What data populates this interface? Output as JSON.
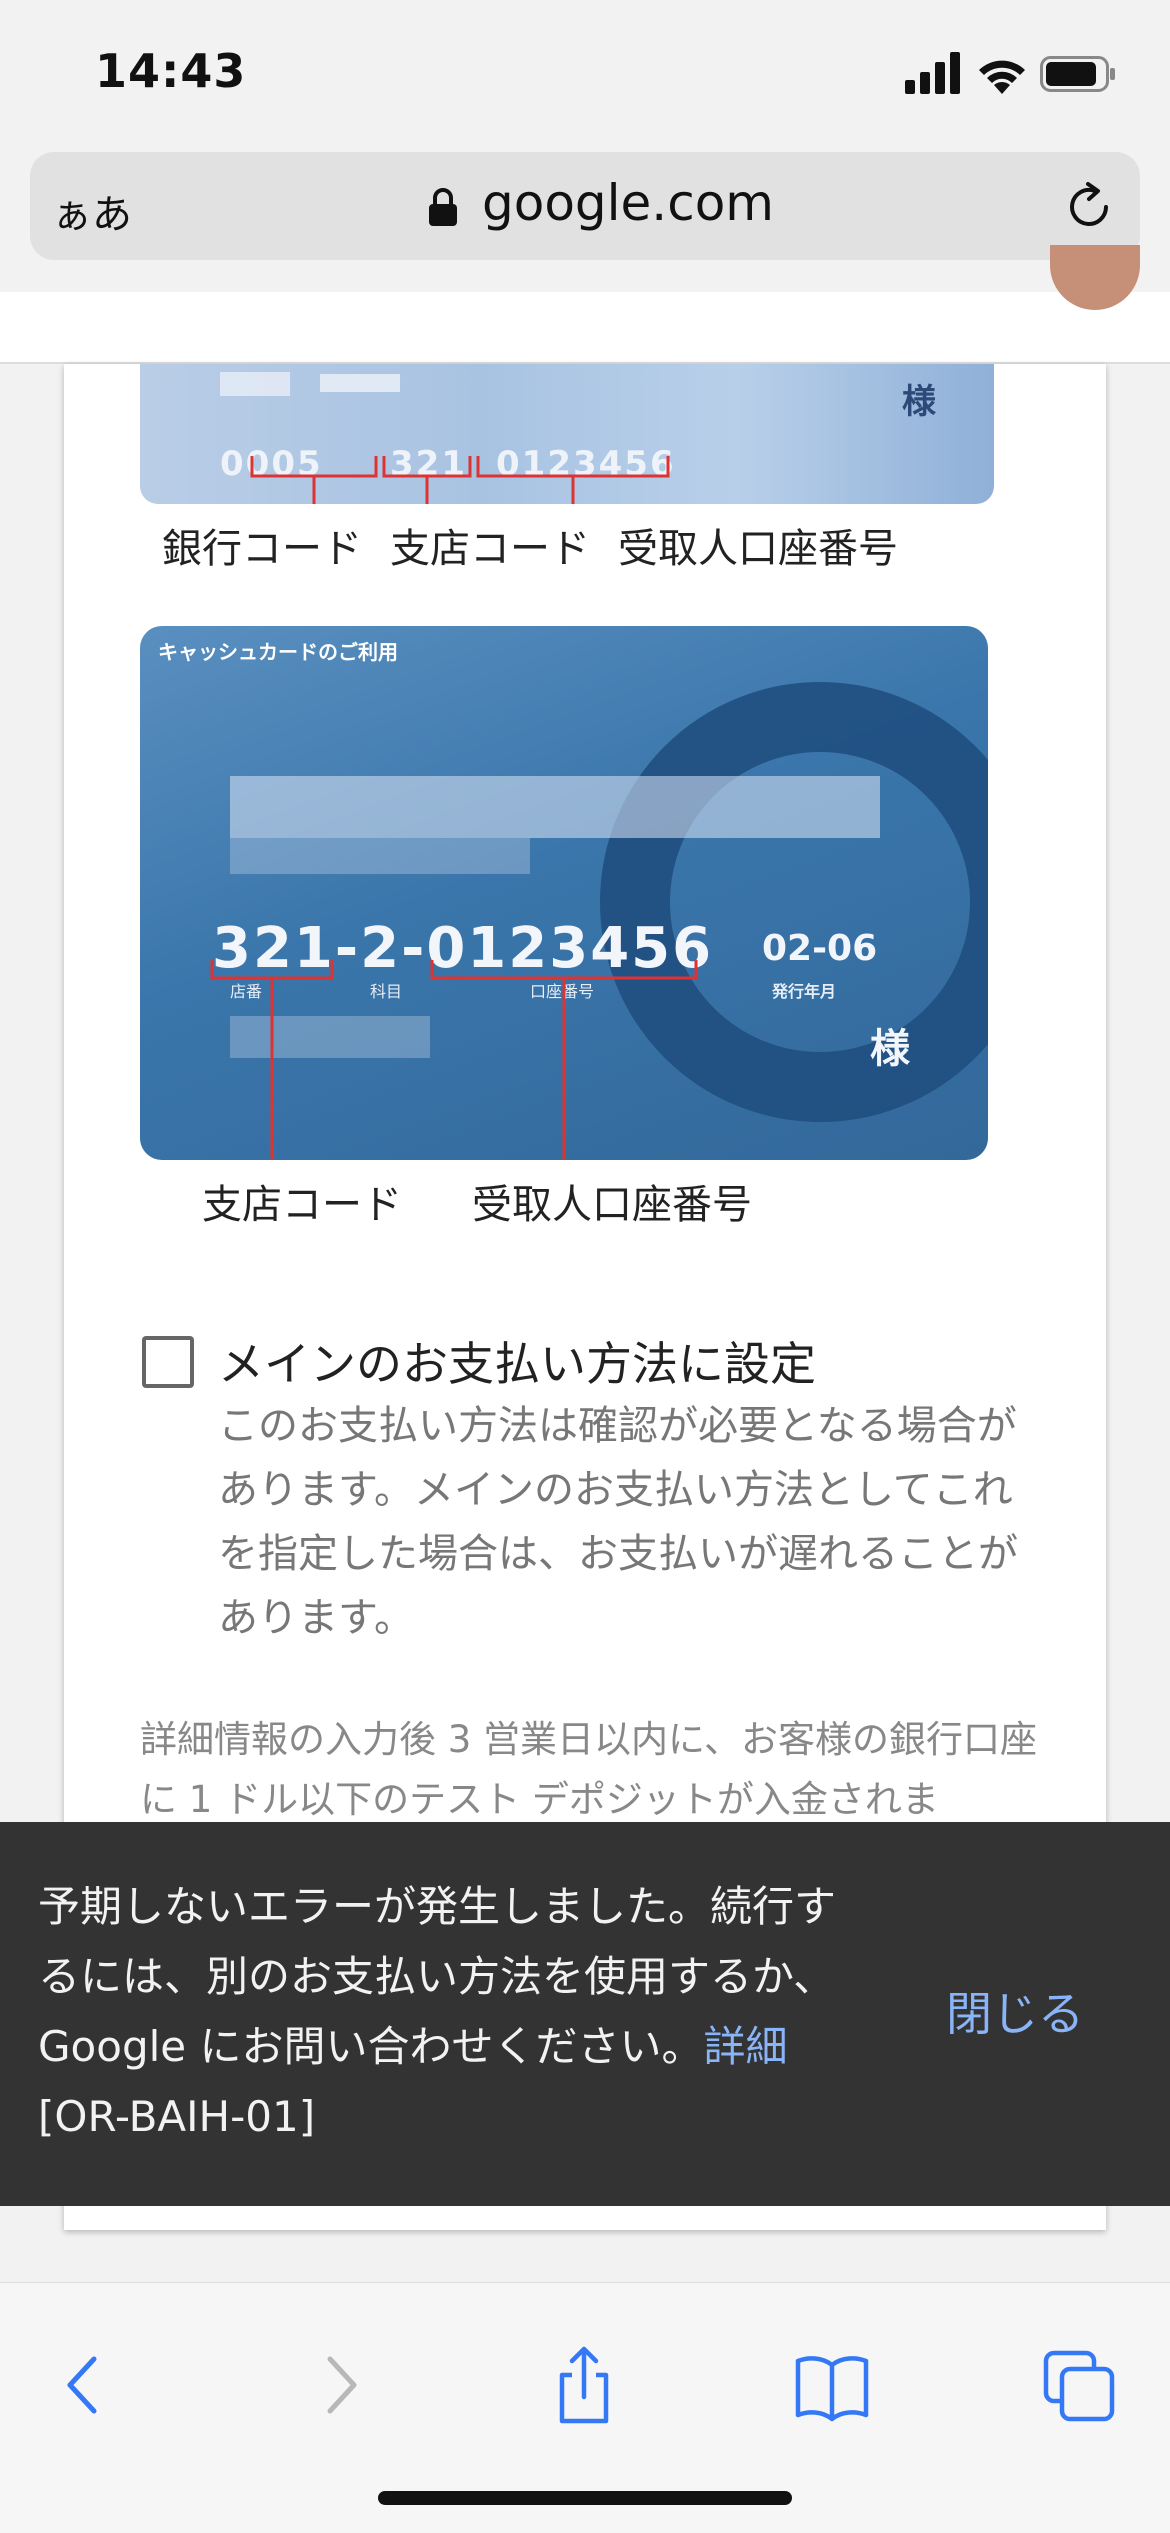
{
  "status_bar": {
    "time": "14:43"
  },
  "browser": {
    "text_size_label": "ぁあ",
    "domain": "google.com"
  },
  "cards": {
    "card1_labels": [
      "銀行コード",
      "支店コード",
      "受取人口座番号"
    ],
    "card1_digits": [
      "0005",
      "321",
      "0123456"
    ],
    "card1_honorific": "様",
    "card2_header": "キャッシュカードのご利用",
    "card2_number": "321-2-0123456",
    "card2_field_labels": [
      "店番",
      "科目",
      "口座番号"
    ],
    "card2_expiry": "02-06",
    "card2_expiry_label": "発行年月",
    "card2_honorific": "様",
    "card2_labels": [
      "支店コード",
      "受取人口座番号"
    ]
  },
  "primary_payment": {
    "label": "メインのお支払い方法に設定",
    "description": "このお支払い方法は確認が必要となる場合があります。メインのお支払い方法としてこれを指定した場合は、お支払いが遅れることがあります。"
  },
  "deposit_note": "詳細情報の入力後 3 営業日以内に、お客様の銀行口座に 1 ドル以下のテスト デポジットが入金されま",
  "toast": {
    "message": "予期しないエラーが発生しました。続行するには、別のお支払い方法を使用するか、Google にお問い合わせください。",
    "link_label": "詳細",
    "code": " [OR-BAIH-01]",
    "close_label": "閉じる"
  },
  "colors": {
    "link": "#8ab4f8",
    "toast_bg": "#333333",
    "ios_blue": "#3478f6"
  }
}
